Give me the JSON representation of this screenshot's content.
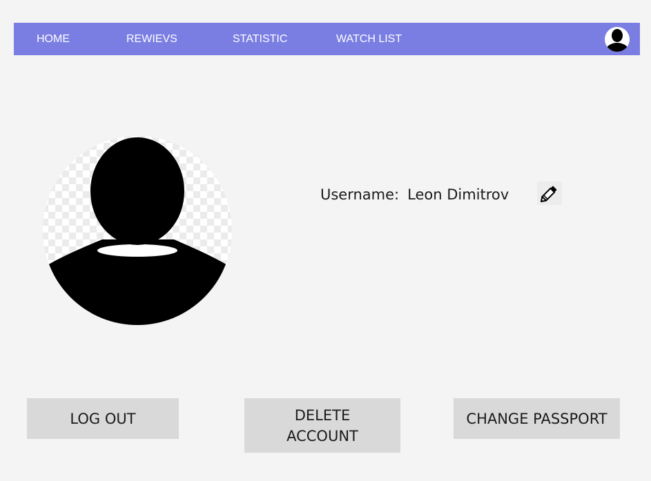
{
  "nav": {
    "items": [
      {
        "label": "HOME"
      },
      {
        "label": "REWIEVS"
      },
      {
        "label": "STATISTIC"
      },
      {
        "label": "WATCH LIST"
      }
    ],
    "avatar_icon": "user-avatar-icon",
    "bg_color": "#7a7ee2"
  },
  "profile": {
    "picture_icon": "user-silhouette-icon",
    "username_label": "Username:",
    "username_value": "Leon Dimitrov",
    "edit_icon": "pencil-icon"
  },
  "actions": {
    "logout_label": "LOG OUT",
    "delete_line1": "DELETE",
    "delete_line2": "ACCOUNT",
    "change_label": "CHANGE PASSPORT"
  }
}
